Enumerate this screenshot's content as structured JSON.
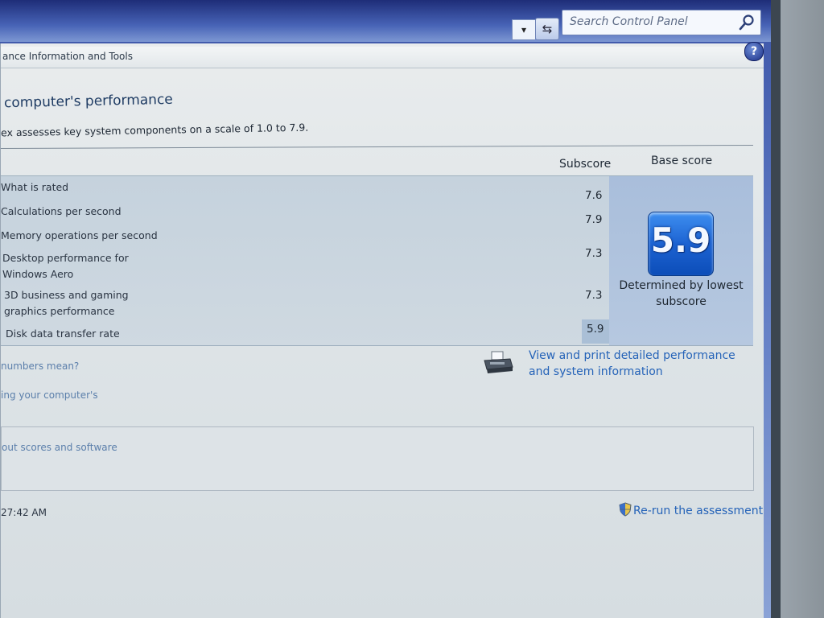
{
  "topbar": {
    "dropdown_arrow": "▾",
    "refresh_glyph": "⇆",
    "search": {
      "placeholder": "Search Control Panel"
    }
  },
  "breadcrumb": {
    "text": "ance Information and Tools"
  },
  "help": {
    "label": "?"
  },
  "page": {
    "title": "computer's performance",
    "description": "ex assesses key system components on a scale of 1.0 to 7.9."
  },
  "table": {
    "headers": {
      "subscore": "Subscore",
      "base_score": "Base score"
    },
    "rows": [
      {
        "label": "What is rated",
        "score": "7.6"
      },
      {
        "label": "Calculations per second",
        "score": "7.9"
      },
      {
        "label": "Memory operations per second",
        "score": ""
      },
      {
        "label": "Desktop performance for Windows Aero",
        "score": "7.3"
      },
      {
        "label": "3D business and gaming graphics performance",
        "score": "7.3"
      },
      {
        "label": "Disk data transfer rate",
        "score": "5.9"
      }
    ],
    "base_score": {
      "value": "5.9",
      "caption": "Determined by lowest subscore"
    }
  },
  "links": {
    "view_print": "View and print detailed performance and system information",
    "numbers_mean": "numbers mean?",
    "improving": "ing your computer's",
    "about_scores": "out scores and software",
    "rerun": "Re-run the assessment"
  },
  "footer": {
    "timestamp": "27:42 AM"
  },
  "colors": {
    "accent": "#2563b8",
    "tile": "#1d63d2",
    "panel": "#a9bedb"
  }
}
